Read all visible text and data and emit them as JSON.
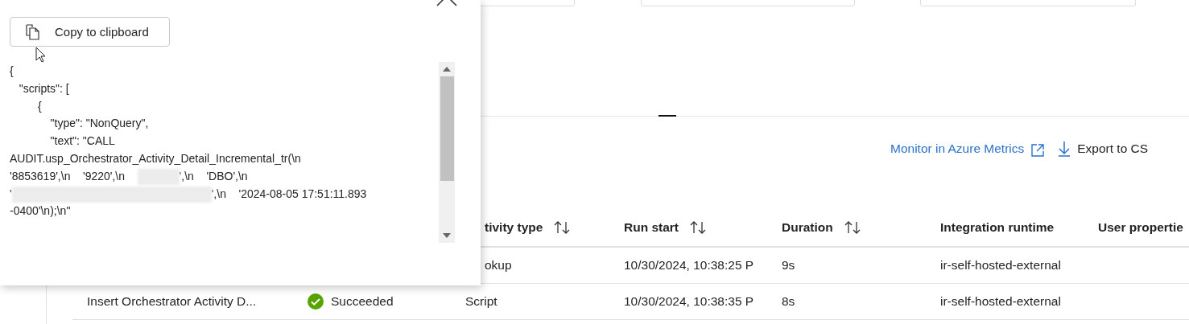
{
  "panel": {
    "copy_button": "Copy to clipboard",
    "code_lines": [
      [
        {
          "kind": "text",
          "text": "{"
        }
      ],
      [
        {
          "kind": "text",
          "text": "   \"scripts\": ["
        }
      ],
      [
        {
          "kind": "text",
          "text": "         {"
        }
      ],
      [
        {
          "kind": "text",
          "text": "             \"type\": \"NonQuery\","
        }
      ],
      [
        {
          "kind": "text",
          "text": "             \"text\": \"CALL"
        }
      ],
      [
        {
          "kind": "text",
          "text": "AUDIT.usp_Orchestrator_Activity_Detail_Incremental_tr(\\n"
        }
      ],
      [
        {
          "kind": "text",
          "text": "'8853619',\\n    '9220',\\n    "
        },
        {
          "kind": "redacted_short"
        },
        {
          "kind": "text",
          "text": "',\\n    'DBO',\\n"
        }
      ],
      [
        {
          "kind": "text",
          "text": "'"
        },
        {
          "kind": "redacted_long"
        },
        {
          "kind": "text",
          "text": "',\\n    '2024-08-05 17:51:11.893"
        }
      ],
      [
        {
          "kind": "text",
          "text": "-0400'\\n);\\n\""
        }
      ]
    ]
  },
  "toolbar": {
    "metrics_link": "Monitor in Azure Metrics",
    "export_button": "Export to CS"
  },
  "table": {
    "columns": [
      {
        "label": "tivity type",
        "sortable": true
      },
      {
        "label": "Run start",
        "sortable": true
      },
      {
        "label": "Duration",
        "sortable": true
      },
      {
        "label": "Integration runtime",
        "sortable": false
      },
      {
        "label": "User propertie",
        "sortable": false
      }
    ],
    "rows": [
      {
        "activity_type": "okup",
        "run_start": "10/30/2024, 10:38:25 P",
        "duration": "9s",
        "runtime": "ir-self-hosted-external"
      },
      {
        "name": "Insert Orchestrator Activity D...",
        "status": "Succeeded",
        "activity_type": "Script",
        "run_start": "10/30/2024, 10:38:35 P",
        "duration": "8s",
        "runtime": "ir-self-hosted-external"
      }
    ]
  }
}
